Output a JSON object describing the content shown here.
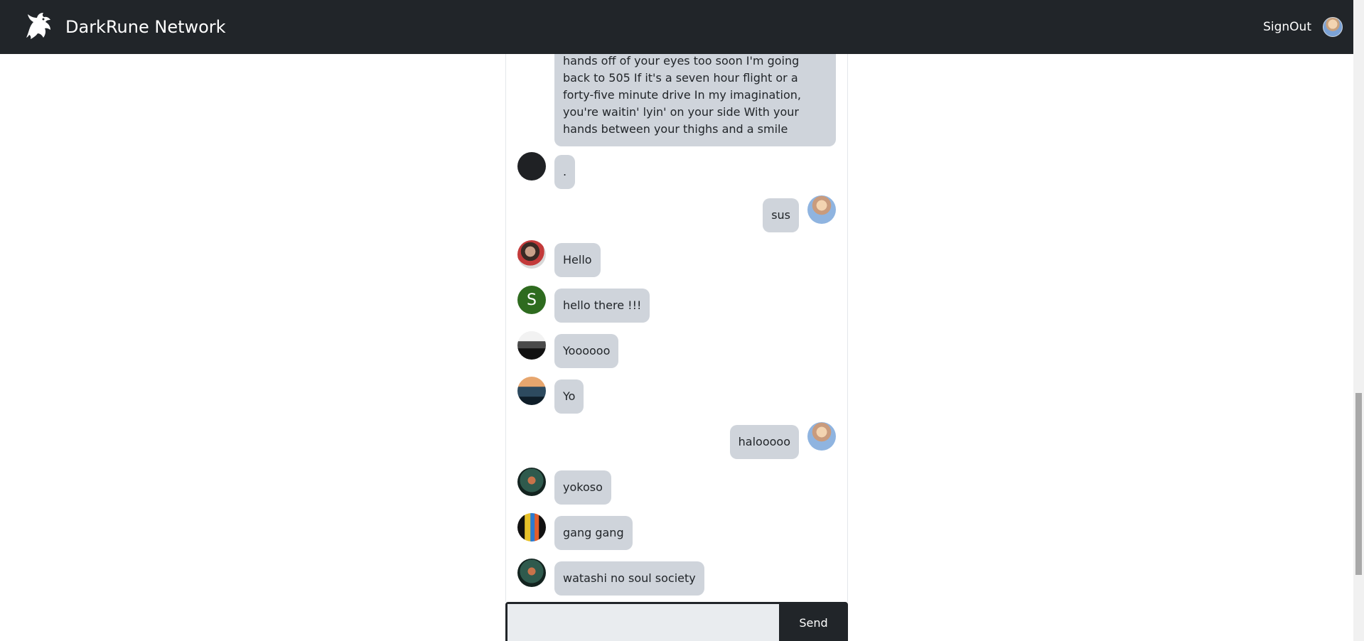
{
  "navbar": {
    "brand_name": "DarkRune Network",
    "logo_icon": "dragon-icon",
    "signout_label": "SignOut"
  },
  "chat": {
    "messages": [
      {
        "mine": false,
        "avatar": "none",
        "text": "hands off of your eyes too soon I'm going back to 505 If it's a seven hour flight or a forty-five minute drive In my imagination, you're waitin' lyin' on your side With your hands between your thighs and a smile"
      },
      {
        "mine": false,
        "avatar": "dark-circle-avatar",
        "text": "."
      },
      {
        "mine": true,
        "avatar": "me-avatar",
        "text": "sus"
      },
      {
        "mine": false,
        "avatar": "photo-avatar",
        "text": "Hello"
      },
      {
        "mine": false,
        "avatar": "letter-avatar",
        "avatar_letter": "S",
        "text": "hello there !!!"
      },
      {
        "mine": false,
        "avatar": "bw-photo-avatar",
        "text": "Yoooooo"
      },
      {
        "mine": false,
        "avatar": "sky-photo-avatar",
        "text": "Yo"
      },
      {
        "mine": true,
        "avatar": "me-avatar",
        "text": "halooooo"
      },
      {
        "mine": false,
        "avatar": "forest-photo-avatar",
        "text": "yokoso"
      },
      {
        "mine": false,
        "avatar": "k-photo-avatar",
        "text": "gang gang"
      },
      {
        "mine": false,
        "avatar": "forest-photo-avatar",
        "text": "watashi no soul society"
      }
    ]
  },
  "composer": {
    "input_value": "",
    "input_placeholder": "",
    "send_label": "Send"
  },
  "colors": {
    "navbar_bg": "#212529",
    "bubble_bg": "#cfd4db",
    "input_bg": "#e9ecef"
  }
}
